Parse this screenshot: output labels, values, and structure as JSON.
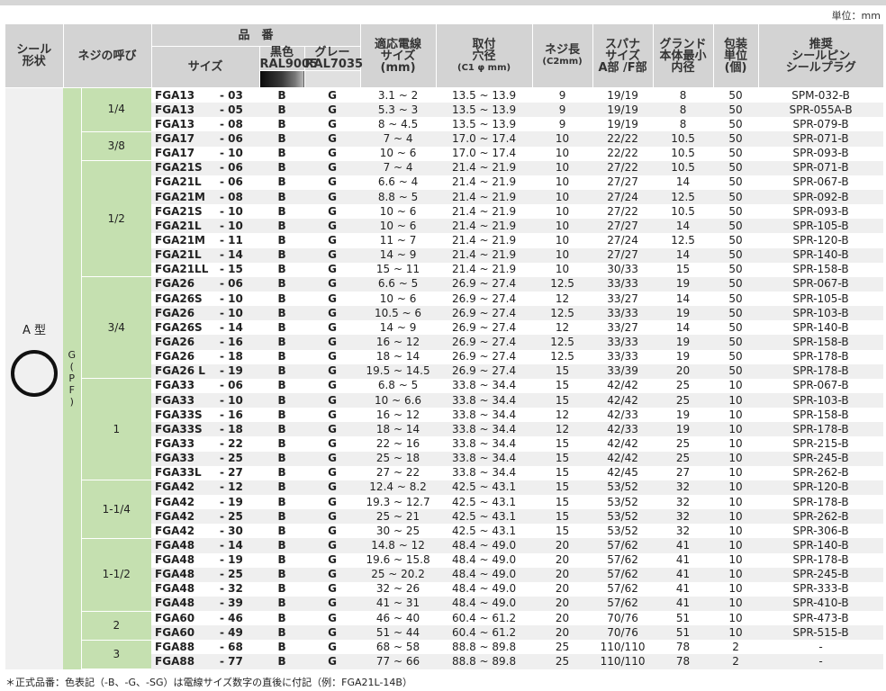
{
  "unit_label": "単位：mm",
  "headers": {
    "seal_shape": "シール\n形状",
    "thread_name": "ネジの呼び",
    "part_no": "品　番",
    "size": "サイズ",
    "black": "黒色",
    "black_ral": "RAL9005",
    "grey": "グレー",
    "grey_ral": "RAL7035",
    "cable_size": "適応電線\nサイズ\n(mm)",
    "hole": "取付\n穴径",
    "hole_sub": "(C1 φ mm)",
    "thread_len": "ネジ長",
    "thread_len_sub": "(C2mm)",
    "spanner": "スパナ\nサイズ\nA部 /F部",
    "gland": "グランド\n本体最小\n内径",
    "pack": "包装\n単位\n(個)",
    "seal_pin": "推奨\nシールピン\nシールプラグ"
  },
  "seal_type": "A 型",
  "g_label": "G\n(\nP\nF\n)",
  "groups": [
    {
      "thread": "1/4",
      "rows": 3
    },
    {
      "thread": "3/8",
      "rows": 2
    },
    {
      "thread": "1/2",
      "rows": 8
    },
    {
      "thread": "3/4",
      "rows": 7
    },
    {
      "thread": "1",
      "rows": 7
    },
    {
      "thread": "1-1/4",
      "rows": 4
    },
    {
      "thread": "1-1/2",
      "rows": 5
    },
    {
      "thread": "2",
      "rows": 2
    },
    {
      "thread": "3",
      "rows": 2
    }
  ],
  "rows": [
    [
      "FGA13",
      "- 03",
      "B",
      "G",
      "3.1 ~ 2",
      "13.5 ~ 13.9",
      "9",
      "19/19",
      "8",
      "50",
      "SPM-032-B"
    ],
    [
      "FGA13",
      "- 05",
      "B",
      "G",
      "5.3 ~ 3",
      "13.5 ~ 13.9",
      "9",
      "19/19",
      "8",
      "50",
      "SPR-055A-B"
    ],
    [
      "FGA13",
      "- 08",
      "B",
      "G",
      "8 ~ 4.5",
      "13.5 ~ 13.9",
      "9",
      "19/19",
      "8",
      "50",
      "SPR-079-B"
    ],
    [
      "FGA17",
      "- 06",
      "B",
      "G",
      "7 ~ 4",
      "17.0 ~ 17.4",
      "10",
      "22/22",
      "10.5",
      "50",
      "SPR-071-B"
    ],
    [
      "FGA17",
      "- 10",
      "B",
      "G",
      "10 ~ 6",
      "17.0 ~ 17.4",
      "10",
      "22/22",
      "10.5",
      "50",
      "SPR-093-B"
    ],
    [
      "FGA21S",
      "- 06",
      "B",
      "G",
      "7 ~ 4",
      "21.4 ~ 21.9",
      "10",
      "27/22",
      "10.5",
      "50",
      "SPR-071-B"
    ],
    [
      "FGA21L",
      "- 06",
      "B",
      "G",
      "6.6 ~ 4",
      "21.4 ~ 21.9",
      "10",
      "27/27",
      "14",
      "50",
      "SPR-067-B"
    ],
    [
      "FGA21M",
      "- 08",
      "B",
      "G",
      "8.8 ~ 5",
      "21.4 ~ 21.9",
      "10",
      "27/24",
      "12.5",
      "50",
      "SPR-092-B"
    ],
    [
      "FGA21S",
      "- 10",
      "B",
      "G",
      "10 ~ 6",
      "21.4 ~ 21.9",
      "10",
      "27/22",
      "10.5",
      "50",
      "SPR-093-B"
    ],
    [
      "FGA21L",
      "- 10",
      "B",
      "G",
      "10 ~ 6",
      "21.4 ~ 21.9",
      "10",
      "27/27",
      "14",
      "50",
      "SPR-105-B"
    ],
    [
      "FGA21M",
      "- 11",
      "B",
      "G",
      "11 ~ 7",
      "21.4 ~ 21.9",
      "10",
      "27/24",
      "12.5",
      "50",
      "SPR-120-B"
    ],
    [
      "FGA21L",
      "- 14",
      "B",
      "G",
      "14 ~ 9",
      "21.4 ~ 21.9",
      "10",
      "27/27",
      "14",
      "50",
      "SPR-140-B"
    ],
    [
      "FGA21LL",
      "- 15",
      "B",
      "G",
      "15 ~ 11",
      "21.4 ~ 21.9",
      "10",
      "30/33",
      "15",
      "50",
      "SPR-158-B"
    ],
    [
      "FGA26",
      "- 06",
      "B",
      "G",
      "6.6 ~ 5",
      "26.9 ~ 27.4",
      "12.5",
      "33/33",
      "19",
      "50",
      "SPR-067-B"
    ],
    [
      "FGA26S",
      "- 10",
      "B",
      "G",
      "10 ~ 6",
      "26.9 ~ 27.4",
      "12",
      "33/27",
      "14",
      "50",
      "SPR-105-B"
    ],
    [
      "FGA26",
      "- 10",
      "B",
      "G",
      "10.5 ~ 6",
      "26.9 ~ 27.4",
      "12.5",
      "33/33",
      "19",
      "50",
      "SPR-103-B"
    ],
    [
      "FGA26S",
      "- 14",
      "B",
      "G",
      "14 ~ 9",
      "26.9 ~ 27.4",
      "12",
      "33/27",
      "14",
      "50",
      "SPR-140-B"
    ],
    [
      "FGA26",
      "- 16",
      "B",
      "G",
      "16 ~ 12",
      "26.9 ~ 27.4",
      "12.5",
      "33/33",
      "19",
      "50",
      "SPR-158-B"
    ],
    [
      "FGA26",
      "- 18",
      "B",
      "G",
      "18 ~ 14",
      "26.9 ~ 27.4",
      "12.5",
      "33/33",
      "19",
      "50",
      "SPR-178-B"
    ],
    [
      "FGA26 L",
      "- 19",
      "B",
      "G",
      "19.5 ~ 14.5",
      "26.9 ~ 27.4",
      "15",
      "33/39",
      "20",
      "50",
      "SPR-178-B"
    ],
    [
      "FGA33",
      "- 06",
      "B",
      "G",
      "6.8 ~ 5",
      "33.8 ~ 34.4",
      "15",
      "42/42",
      "25",
      "10",
      "SPR-067-B"
    ],
    [
      "FGA33",
      "- 10",
      "B",
      "G",
      "10 ~ 6.6",
      "33.8 ~ 34.4",
      "15",
      "42/42",
      "25",
      "10",
      "SPR-103-B"
    ],
    [
      "FGA33S",
      "- 16",
      "B",
      "G",
      "16 ~ 12",
      "33.8 ~ 34.4",
      "12",
      "42/33",
      "19",
      "10",
      "SPR-158-B"
    ],
    [
      "FGA33S",
      "- 18",
      "B",
      "G",
      "18 ~ 14",
      "33.8 ~ 34.4",
      "12",
      "42/33",
      "19",
      "10",
      "SPR-178-B"
    ],
    [
      "FGA33",
      "- 22",
      "B",
      "G",
      "22 ~ 16",
      "33.8 ~ 34.4",
      "15",
      "42/42",
      "25",
      "10",
      "SPR-215-B"
    ],
    [
      "FGA33",
      "- 25",
      "B",
      "G",
      "25 ~ 18",
      "33.8 ~ 34.4",
      "15",
      "42/42",
      "25",
      "10",
      "SPR-245-B"
    ],
    [
      "FGA33L",
      "- 27",
      "B",
      "G",
      "27 ~ 22",
      "33.8 ~ 34.4",
      "15",
      "42/45",
      "27",
      "10",
      "SPR-262-B"
    ],
    [
      "FGA42",
      "- 12",
      "B",
      "G",
      "12.4 ~ 8.2",
      "42.5 ~ 43.1",
      "15",
      "53/52",
      "32",
      "10",
      "SPR-120-B"
    ],
    [
      "FGA42",
      "- 19",
      "B",
      "G",
      "19.3 ~ 12.7",
      "42.5 ~ 43.1",
      "15",
      "53/52",
      "32",
      "10",
      "SPR-178-B"
    ],
    [
      "FGA42",
      "- 25",
      "B",
      "G",
      "25 ~ 21",
      "42.5 ~ 43.1",
      "15",
      "53/52",
      "32",
      "10",
      "SPR-262-B"
    ],
    [
      "FGA42",
      "- 30",
      "B",
      "G",
      "30 ~ 25",
      "42.5 ~ 43.1",
      "15",
      "53/52",
      "32",
      "10",
      "SPR-306-B"
    ],
    [
      "FGA48",
      "- 14",
      "B",
      "G",
      "14.8 ~ 12",
      "48.4 ~ 49.0",
      "20",
      "57/62",
      "41",
      "10",
      "SPR-140-B"
    ],
    [
      "FGA48",
      "- 19",
      "B",
      "G",
      "19.6 ~ 15.8",
      "48.4 ~ 49.0",
      "20",
      "57/62",
      "41",
      "10",
      "SPR-178-B"
    ],
    [
      "FGA48",
      "- 25",
      "B",
      "G",
      "25 ~ 20.2",
      "48.4 ~ 49.0",
      "20",
      "57/62",
      "41",
      "10",
      "SPR-245-B"
    ],
    [
      "FGA48",
      "- 32",
      "B",
      "G",
      "32 ~ 26",
      "48.4 ~ 49.0",
      "20",
      "57/62",
      "41",
      "10",
      "SPR-333-B"
    ],
    [
      "FGA48",
      "- 39",
      "B",
      "G",
      "41 ~ 31",
      "48.4 ~ 49.0",
      "20",
      "57/62",
      "41",
      "10",
      "SPR-410-B"
    ],
    [
      "FGA60",
      "- 46",
      "B",
      "G",
      "46 ~ 40",
      "60.4 ~ 61.2",
      "20",
      "70/76",
      "51",
      "10",
      "SPR-473-B"
    ],
    [
      "FGA60",
      "- 49",
      "B",
      "G",
      "51 ~ 44",
      "60.4 ~ 61.2",
      "20",
      "70/76",
      "51",
      "10",
      "SPR-515-B"
    ],
    [
      "FGA88",
      "- 68",
      "B",
      "G",
      "68 ~ 58",
      "88.8 ~ 89.8",
      "25",
      "110/110",
      "78",
      "2",
      "-"
    ],
    [
      "FGA88",
      "- 77",
      "B",
      "G",
      "77 ~ 66",
      "88.8 ~ 89.8",
      "25",
      "110/110",
      "78",
      "2",
      "-"
    ]
  ],
  "footnote": "＊正式品番：色表記（-B、-G、-SG）は電線サイズ数字の直後に付記（例：FGA21L-14B）"
}
